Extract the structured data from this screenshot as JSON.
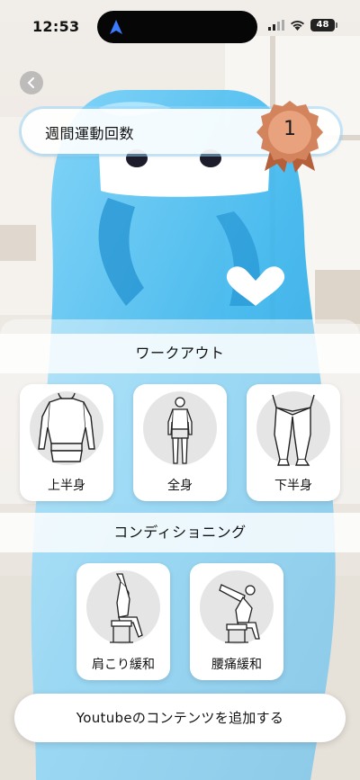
{
  "status_bar": {
    "time": "12:53",
    "battery_level": "48",
    "icons": [
      "location-arrow-icon",
      "signal-bars-icon",
      "wifi-icon",
      "battery-icon"
    ]
  },
  "header": {
    "back_icon": "chevron-left-icon",
    "weekly_label": "週間運動回数",
    "weekly_count": "1",
    "medal_icon": "bronze-medal-icon"
  },
  "workout": {
    "title": "ワークアウト",
    "items": [
      {
        "label": "上半身",
        "icon": "upper-body-icon"
      },
      {
        "label": "全身",
        "icon": "full-body-icon"
      },
      {
        "label": "下半身",
        "icon": "lower-body-icon"
      }
    ]
  },
  "conditioning": {
    "title": "コンディショニング",
    "items": [
      {
        "label": "肩こり緩和",
        "icon": "shoulder-stretch-icon"
      },
      {
        "label": "腰痛緩和",
        "icon": "back-stretch-icon"
      }
    ]
  },
  "actions": {
    "add_youtube": "Youtubeのコンテンツを追加する"
  },
  "colors": {
    "mascot": "#3fb9ee",
    "medal": "#d4845d",
    "circle": "#e5e5e5"
  }
}
